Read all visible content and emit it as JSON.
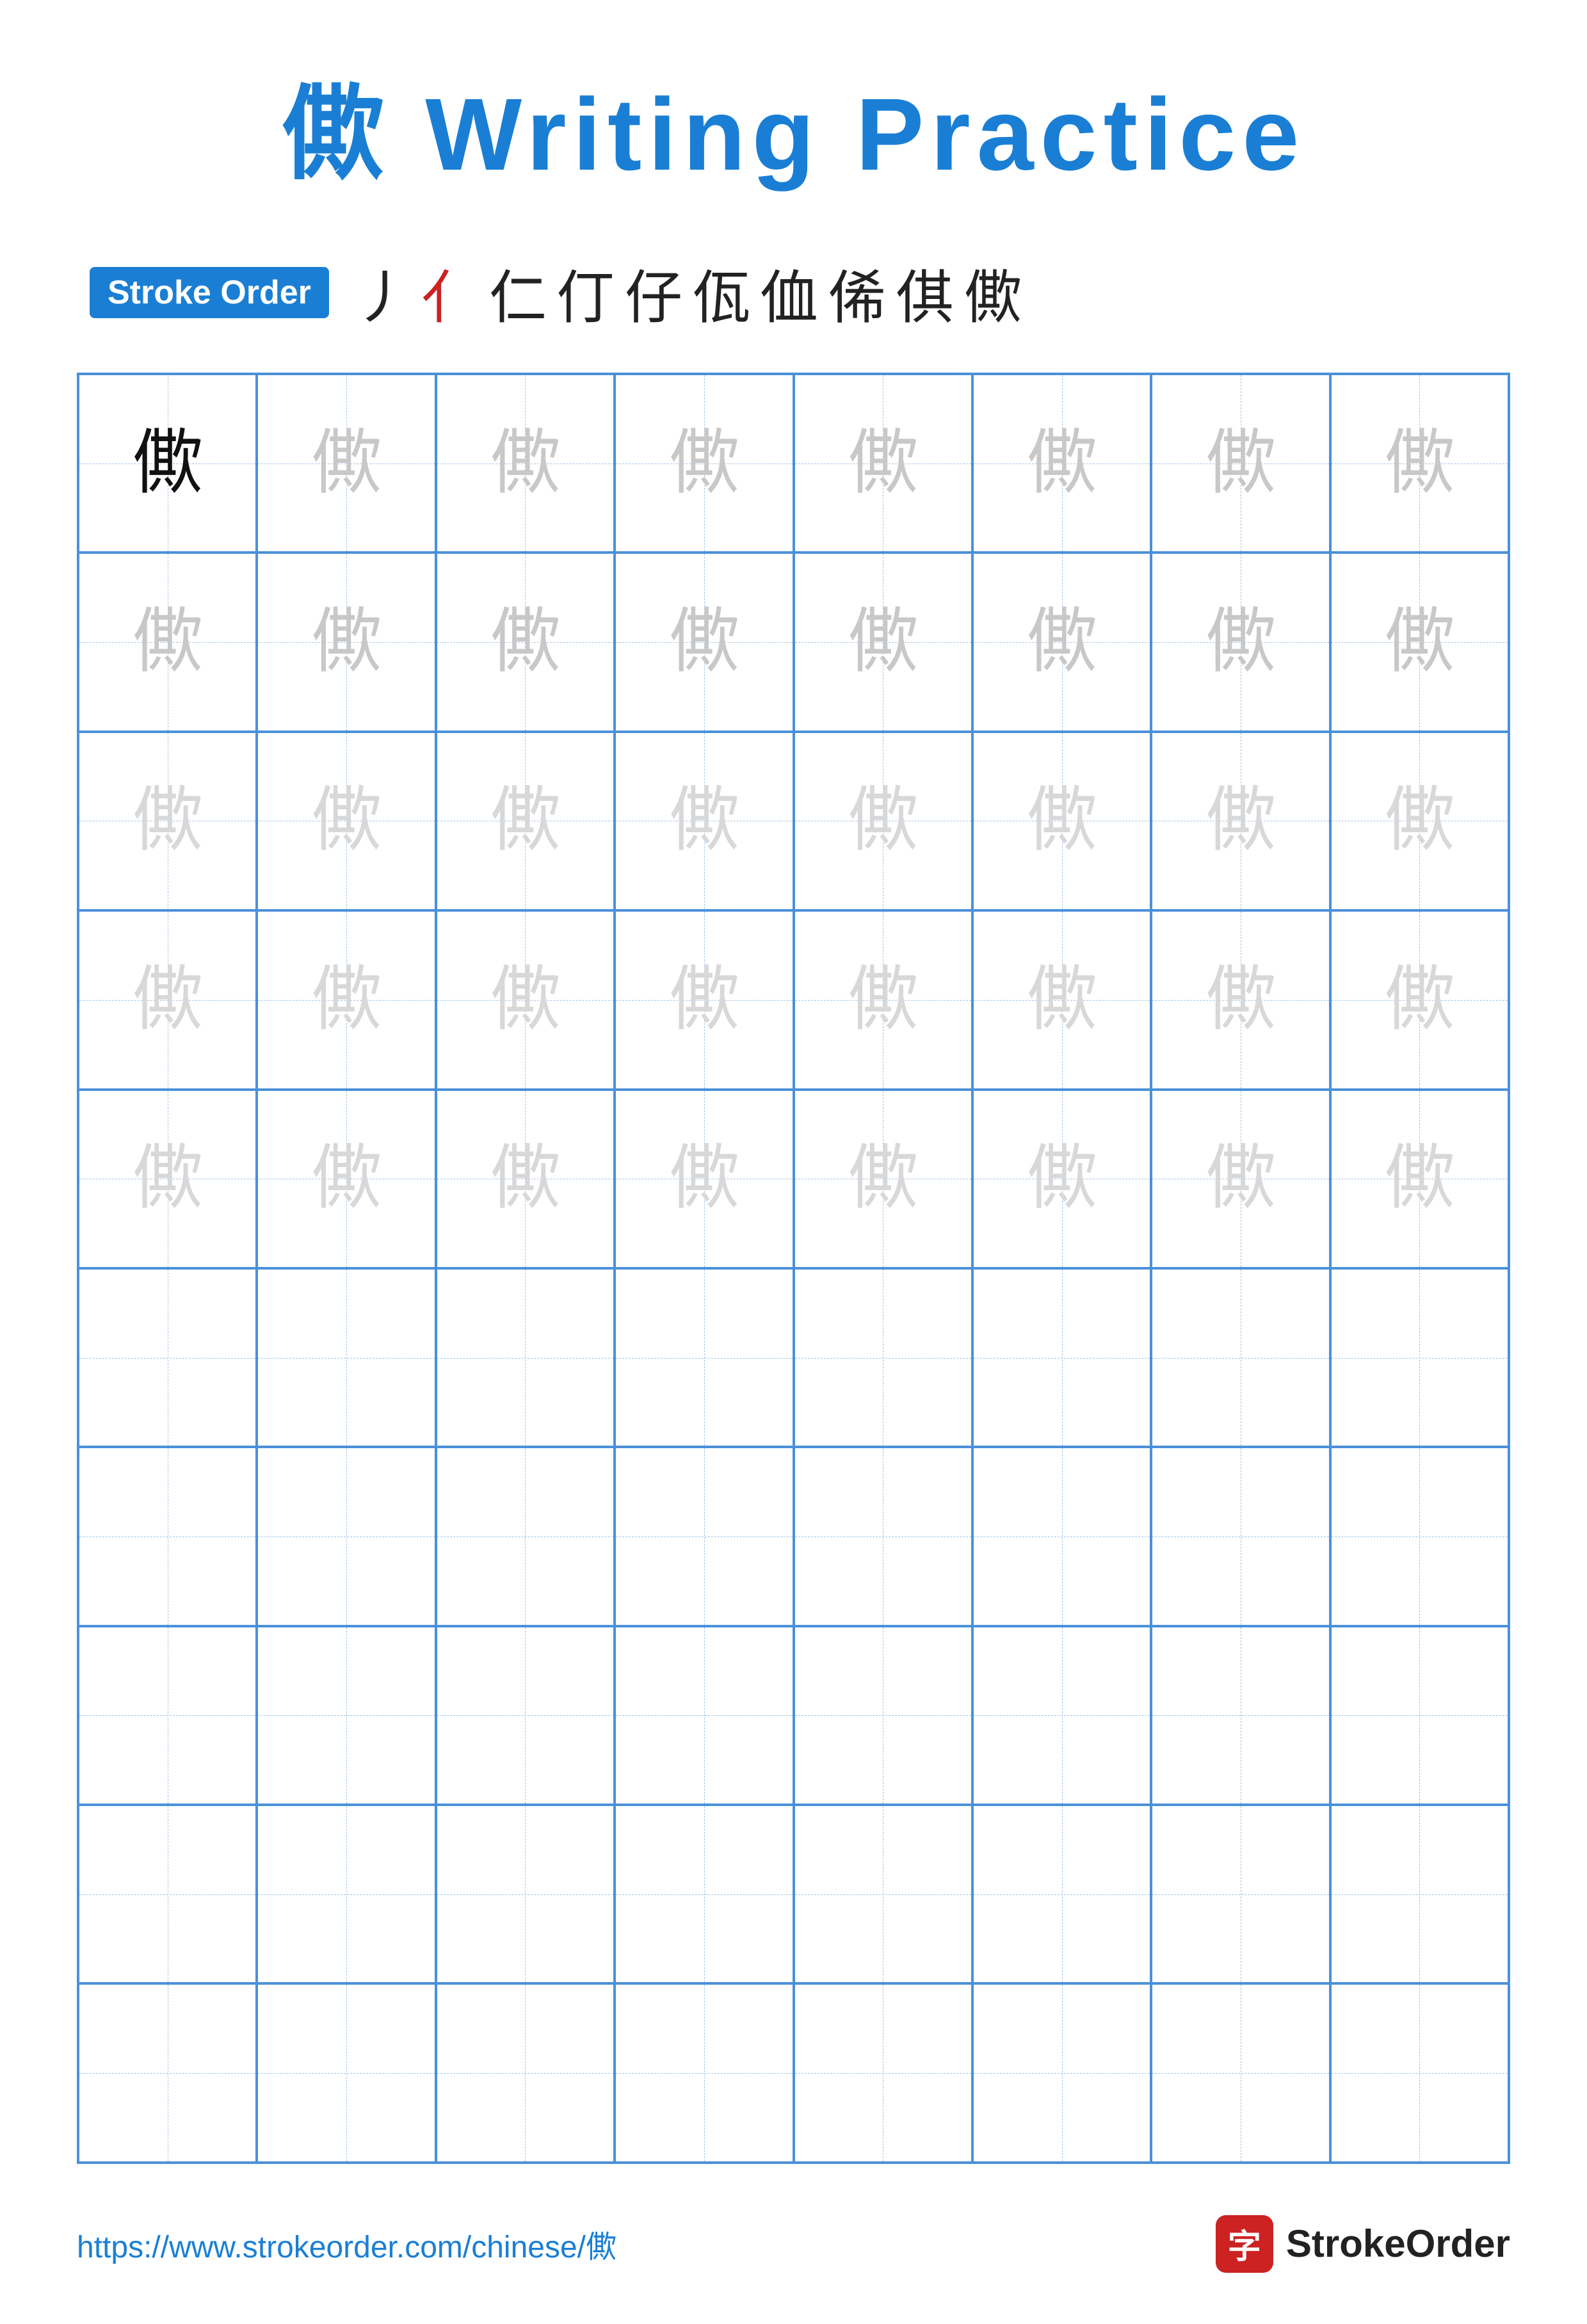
{
  "title": {
    "char": "僛",
    "text": " Writing Practice"
  },
  "stroke_order": {
    "badge_label": "Stroke Order",
    "strokes": [
      {
        "char": "⼃",
        "color": "dark"
      },
      {
        "char": "亻",
        "color": "red"
      },
      {
        "char": "仁",
        "color": "dark"
      },
      {
        "char": "仃",
        "color": "dark"
      },
      {
        "char": "仔",
        "color": "dark"
      },
      {
        "char": "佤",
        "color": "dark"
      },
      {
        "char": "侐",
        "color": "dark"
      },
      {
        "char": "俙",
        "color": "dark"
      },
      {
        "char": "倛",
        "color": "dark"
      },
      {
        "char": "僛",
        "color": "dark"
      }
    ]
  },
  "grid": {
    "rows": 10,
    "cols": 8,
    "char": "僛",
    "filled_rows": [
      {
        "row": 0,
        "cells": [
          {
            "opacity": "dark"
          },
          {
            "opacity": "light"
          },
          {
            "opacity": "light"
          },
          {
            "opacity": "light"
          },
          {
            "opacity": "light"
          },
          {
            "opacity": "light"
          },
          {
            "opacity": "light"
          },
          {
            "opacity": "light"
          }
        ]
      },
      {
        "row": 1,
        "cells": [
          {
            "opacity": "light"
          },
          {
            "opacity": "light"
          },
          {
            "opacity": "light"
          },
          {
            "opacity": "light"
          },
          {
            "opacity": "light"
          },
          {
            "opacity": "light"
          },
          {
            "opacity": "light"
          },
          {
            "opacity": "light"
          }
        ]
      },
      {
        "row": 2,
        "cells": [
          {
            "opacity": "lighter"
          },
          {
            "opacity": "lighter"
          },
          {
            "opacity": "lighter"
          },
          {
            "opacity": "lighter"
          },
          {
            "opacity": "lighter"
          },
          {
            "opacity": "lighter"
          },
          {
            "opacity": "lighter"
          },
          {
            "opacity": "lighter"
          }
        ]
      },
      {
        "row": 3,
        "cells": [
          {
            "opacity": "lighter"
          },
          {
            "opacity": "lighter"
          },
          {
            "opacity": "lighter"
          },
          {
            "opacity": "lighter"
          },
          {
            "opacity": "lighter"
          },
          {
            "opacity": "lighter"
          },
          {
            "opacity": "lighter"
          },
          {
            "opacity": "lighter"
          }
        ]
      },
      {
        "row": 4,
        "cells": [
          {
            "opacity": "lighter"
          },
          {
            "opacity": "lighter"
          },
          {
            "opacity": "lighter"
          },
          {
            "opacity": "lighter"
          },
          {
            "opacity": "lighter"
          },
          {
            "opacity": "lighter"
          },
          {
            "opacity": "lighter"
          },
          {
            "opacity": "lighter"
          }
        ]
      }
    ]
  },
  "footer": {
    "url": "https://www.strokeorder.com/chinese/僛",
    "brand_name": "StrokeOrder",
    "logo_char": "字"
  }
}
